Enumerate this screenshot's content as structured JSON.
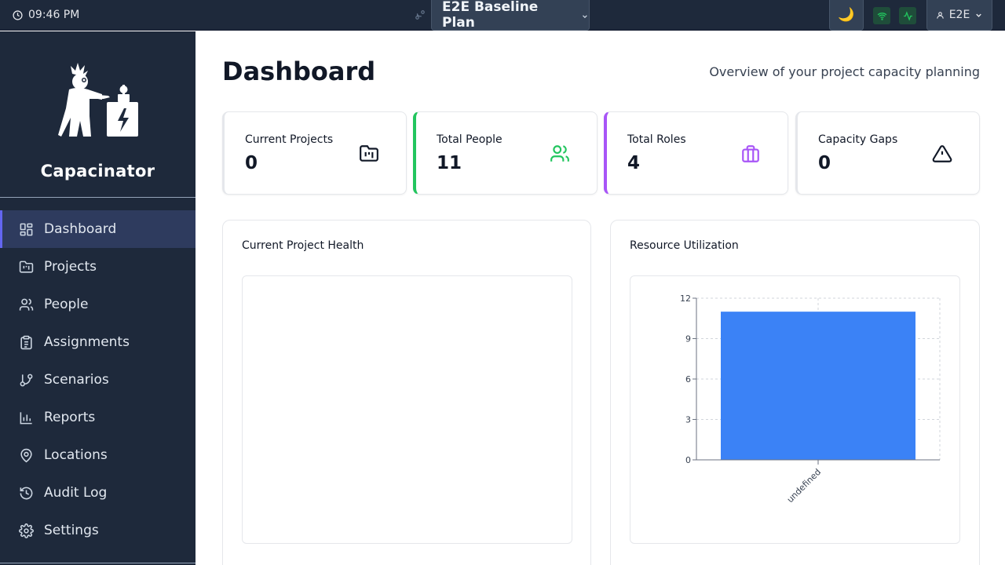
{
  "topbar": {
    "time": "09:46 PM",
    "scenario": "E2E Baseline Plan",
    "theme_icon": "moon-icon",
    "user": "E2E",
    "status_color": "#22c55e"
  },
  "sidebar": {
    "app_name": "Capacinator",
    "items": [
      {
        "label": "Dashboard",
        "icon": "dashboard-icon"
      },
      {
        "label": "Projects",
        "icon": "folder-icon"
      },
      {
        "label": "People",
        "icon": "users-icon"
      },
      {
        "label": "Assignments",
        "icon": "clipboard-icon"
      },
      {
        "label": "Scenarios",
        "icon": "branch-icon"
      },
      {
        "label": "Reports",
        "icon": "bar-chart-icon"
      },
      {
        "label": "Locations",
        "icon": "map-pin-icon"
      },
      {
        "label": "Audit Log",
        "icon": "history-icon"
      },
      {
        "label": "Settings",
        "icon": "gear-icon"
      }
    ]
  },
  "main": {
    "title": "Dashboard",
    "subtitle": "Overview of your project capacity planning",
    "cards": [
      {
        "label": "Current Projects",
        "value": "0",
        "icon": "folder-kanban-icon",
        "accent": "#e5e7eb",
        "icon_color": "#111827"
      },
      {
        "label": "Total People",
        "value": "11",
        "icon": "users-icon",
        "accent": "#22c55e",
        "icon_color": "#22c55e"
      },
      {
        "label": "Total Roles",
        "value": "4",
        "icon": "briefcase-icon",
        "accent": "#a855f7",
        "icon_color": "#a855f7"
      },
      {
        "label": "Capacity Gaps",
        "value": "0",
        "icon": "alert-triangle-icon",
        "accent": "#e5e7eb",
        "icon_color": "#111827"
      }
    ],
    "panels": {
      "health_title": "Current Project Health",
      "utilization_title": "Resource Utilization"
    }
  },
  "chart_data": {
    "type": "bar",
    "categories": [
      "undefined"
    ],
    "values": [
      11
    ],
    "ylim": [
      0,
      12
    ],
    "yticks": [
      0,
      3,
      6,
      9,
      12
    ],
    "bar_color": "#3b82f6",
    "grid": true
  }
}
